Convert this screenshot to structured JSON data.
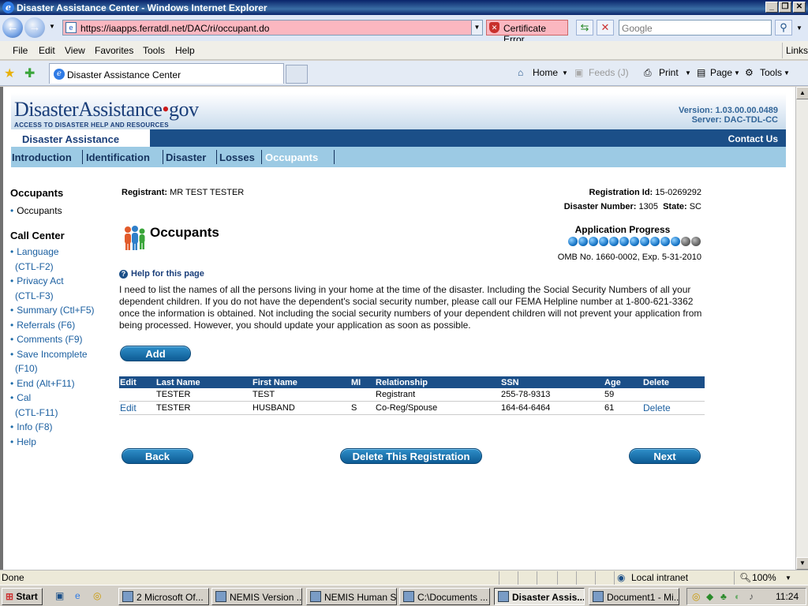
{
  "window": {
    "title": "Disaster Assistance Center - Windows Internet Explorer",
    "min": "_",
    "max": "❐",
    "close": "✕"
  },
  "browser": {
    "address": "https://iaapps.ferratdl.net/DAC/ri/occupant.do",
    "cert_error": "Certificate Error",
    "search_placeholder": "Google",
    "menu": [
      "File",
      "Edit",
      "View",
      "Favorites",
      "Tools",
      "Help"
    ],
    "links_label": "Links",
    "tab_title": "Disaster Assistance Center",
    "toolbar": {
      "home": "Home",
      "feeds": "Feeds (J)",
      "print": "Print",
      "page": "Page",
      "tools": "Tools"
    }
  },
  "site": {
    "logo_main": "DisasterAssistance",
    "logo_dot": "•",
    "logo_tld": "gov",
    "logo_sub": "ACCESS TO DISASTER HELP AND RESOURCES",
    "version": "Version: 1.03.00.00.0489",
    "server": "Server: DAC-TDL-CC",
    "section_tab": "Disaster Assistance",
    "contact": "Contact Us",
    "nav": [
      "Introduction",
      "Identification",
      "Disaster",
      "Losses",
      "Occupants"
    ]
  },
  "sidebar": {
    "heading1": "Occupants",
    "current": "Occupants",
    "heading2": "Call Center",
    "links": [
      {
        "line1": "Language",
        "line2": "(CTL-F2)"
      },
      {
        "line1": "Privacy Act",
        "line2": "(CTL-F3)"
      },
      {
        "line1": "Summary (Ctl+F5)",
        "line2": ""
      },
      {
        "line1": "Referrals (F6)",
        "line2": ""
      },
      {
        "line1": "Comments (F9)",
        "line2": ""
      },
      {
        "line1": "Save Incomplete",
        "line2": "(F10)"
      },
      {
        "line1": "End (Alt+F11)",
        "line2": ""
      },
      {
        "line1": "Cal",
        "line2": "(CTL-F11)"
      },
      {
        "line1": "Info (F8)",
        "line2": ""
      },
      {
        "line1": "Help",
        "line2": ""
      }
    ]
  },
  "main": {
    "registrant_label": "Registrant:",
    "registrant_value": "MR TEST TESTER",
    "regid_label": "Registration Id:",
    "regid_value": "15-0269292",
    "disaster_label": "Disaster Number:",
    "disaster_value": "1305",
    "state_label": "State:",
    "state_value": "SC",
    "title": "Occupants",
    "progress_label": "Application Progress",
    "progress": {
      "completed": 11,
      "total": 13
    },
    "omb": "OMB No. 1660-0002, Exp. 5-31-2010",
    "help_link": "Help for this page",
    "instructions": "I need to list the names of all the persons living in your home at the time of the disaster. Including the Social Security Numbers of all your dependent children. If you do not have the dependent's social security number, please call our FEMA Helpline number at 1-800-621-3362 once the information is obtained. Not including the social security numbers of your dependent children will not prevent your application from being processed. However, you should update your application as soon as possible.",
    "add_button": "Add",
    "table": {
      "headers": [
        "Edit",
        "Last Name",
        "First Name",
        "MI",
        "Relationship",
        "SSN",
        "Age",
        "Delete"
      ],
      "rows": [
        [
          "",
          "TESTER",
          "TEST",
          "",
          "Registrant",
          "255-78-9313",
          "59",
          ""
        ],
        [
          "Edit",
          "TESTER",
          "HUSBAND",
          "S",
          "Co-Reg/Spouse",
          "164-64-6464",
          "61",
          "Delete"
        ]
      ]
    },
    "back_button": "Back",
    "delete_reg_button": "Delete This Registration",
    "next_button": "Next"
  },
  "statusbar": {
    "left": "Done",
    "zone": "Local intranet",
    "zoom": "100%"
  },
  "taskbar": {
    "start": "Start",
    "items": [
      "2 Microsoft Of...",
      "NEMIS Version ...",
      "NEMIS Human S...",
      "C:\\Documents ...",
      "Disaster Assis...",
      "Document1 - Mi..."
    ],
    "clock": "11:24"
  },
  "colors": {
    "brand_blue": "#1b4f88",
    "nav_light": "#9ccae4",
    "cert_error_bg": "#fbb7c0"
  }
}
